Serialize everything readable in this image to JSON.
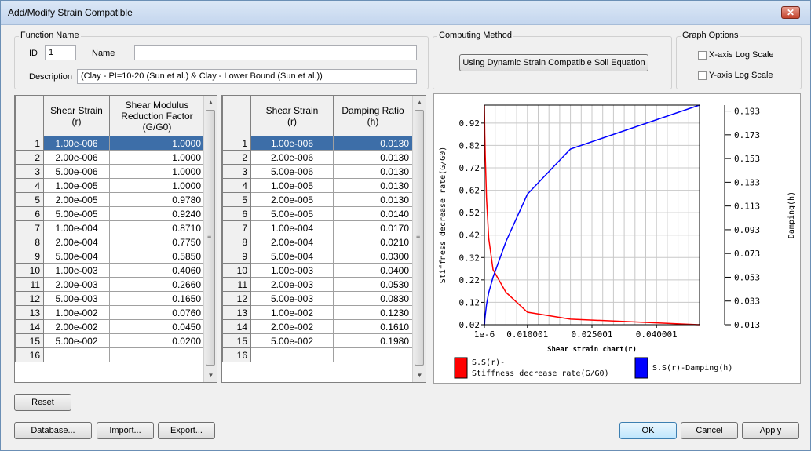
{
  "window": {
    "title": "Add/Modify Strain Compatible",
    "close_glyph": "✕"
  },
  "function_name": {
    "group_label": "Function Name",
    "id_label": "ID",
    "id_value": "1",
    "name_label": "Name",
    "name_value": "",
    "description_label": "Description",
    "description_value": "(Clay - PI=10-20 (Sun et al.) & Clay - Lower Bound (Sun et al.))"
  },
  "computing_method": {
    "group_label": "Computing Method",
    "button_label": "Using Dynamic Strain Compatible Soil Equation"
  },
  "graph_options": {
    "group_label": "Graph Options",
    "x_log_label": "X-axis Log Scale",
    "x_log_checked": false,
    "y_log_label": "Y-axis Log Scale",
    "y_log_checked": false
  },
  "modulus_table": {
    "headers": [
      "Shear Strain\n(r)",
      "Shear Modulus\nReduction Factor\n(G/G0)"
    ],
    "rows": [
      [
        "1",
        "1.00e-006",
        "1.0000"
      ],
      [
        "2",
        "2.00e-006",
        "1.0000"
      ],
      [
        "3",
        "5.00e-006",
        "1.0000"
      ],
      [
        "4",
        "1.00e-005",
        "1.0000"
      ],
      [
        "5",
        "2.00e-005",
        "0.9780"
      ],
      [
        "6",
        "5.00e-005",
        "0.9240"
      ],
      [
        "7",
        "1.00e-004",
        "0.8710"
      ],
      [
        "8",
        "2.00e-004",
        "0.7750"
      ],
      [
        "9",
        "5.00e-004",
        "0.5850"
      ],
      [
        "10",
        "1.00e-003",
        "0.4060"
      ],
      [
        "11",
        "2.00e-003",
        "0.2660"
      ],
      [
        "12",
        "5.00e-003",
        "0.1650"
      ],
      [
        "13",
        "1.00e-002",
        "0.0760"
      ],
      [
        "14",
        "2.00e-002",
        "0.0450"
      ],
      [
        "15",
        "5.00e-002",
        "0.0200"
      ],
      [
        "16",
        "",
        ""
      ]
    ],
    "selected_row": 0
  },
  "damping_table": {
    "headers": [
      "Shear Strain\n(r)",
      "Damping Ratio\n(h)"
    ],
    "rows": [
      [
        "1",
        "1.00e-006",
        "0.0130"
      ],
      [
        "2",
        "2.00e-006",
        "0.0130"
      ],
      [
        "3",
        "5.00e-006",
        "0.0130"
      ],
      [
        "4",
        "1.00e-005",
        "0.0130"
      ],
      [
        "5",
        "2.00e-005",
        "0.0130"
      ],
      [
        "6",
        "5.00e-005",
        "0.0140"
      ],
      [
        "7",
        "1.00e-004",
        "0.0170"
      ],
      [
        "8",
        "2.00e-004",
        "0.0210"
      ],
      [
        "9",
        "5.00e-004",
        "0.0300"
      ],
      [
        "10",
        "1.00e-003",
        "0.0400"
      ],
      [
        "11",
        "2.00e-003",
        "0.0530"
      ],
      [
        "12",
        "5.00e-003",
        "0.0830"
      ],
      [
        "13",
        "1.00e-002",
        "0.1230"
      ],
      [
        "14",
        "2.00e-002",
        "0.1610"
      ],
      [
        "15",
        "5.00e-002",
        "0.1980"
      ],
      [
        "16",
        "",
        ""
      ]
    ],
    "selected_row": 0
  },
  "chart_data": {
    "type": "line",
    "xlabel": "Shear strain chart(r)",
    "ylabel_left": "Stiffness decrease rate(G/G0)",
    "ylabel_right": "Damping(h)",
    "xlim": [
      1e-06,
      0.05
    ],
    "ylim_left": [
      0.02,
      1.0
    ],
    "ylim_right": [
      0.013,
      0.198
    ],
    "x_ticks": [
      "1e-6",
      "0.010001",
      "0.025001",
      "0.040001"
    ],
    "x_tick_values": [
      1e-06,
      0.010001,
      0.025001,
      0.040001
    ],
    "y_ticks_left": [
      "0.92",
      "0.82",
      "0.72",
      "0.62",
      "0.52",
      "0.42",
      "0.32",
      "0.22",
      "0.12",
      "0.02"
    ],
    "y_ticks_right": [
      "0.193",
      "0.173",
      "0.153",
      "0.133",
      "0.113",
      "0.093",
      "0.073",
      "0.053",
      "0.033",
      "0.013"
    ],
    "grid": true,
    "legend_position": "bottom",
    "x": [
      1e-06,
      2e-06,
      5e-06,
      1e-05,
      2e-05,
      5e-05,
      0.0001,
      0.0002,
      0.0005,
      0.001,
      0.002,
      0.005,
      0.01,
      0.02,
      0.05
    ],
    "series": [
      {
        "name": "S.S(r)-\nStiffness decrease rate(G/G0)",
        "color": "#ff0000",
        "axis": "left",
        "values": [
          1.0,
          1.0,
          1.0,
          1.0,
          0.978,
          0.924,
          0.871,
          0.775,
          0.585,
          0.406,
          0.266,
          0.165,
          0.076,
          0.045,
          0.02
        ]
      },
      {
        "name": "S.S(r)-Damping(h)",
        "color": "#0000ff",
        "axis": "right",
        "values": [
          0.013,
          0.013,
          0.013,
          0.013,
          0.013,
          0.014,
          0.017,
          0.021,
          0.03,
          0.04,
          0.053,
          0.083,
          0.123,
          0.161,
          0.198
        ]
      }
    ]
  },
  "buttons": {
    "reset": "Reset",
    "database": "Database...",
    "import": "Import...",
    "export": "Export...",
    "ok": "OK",
    "cancel": "Cancel",
    "apply": "Apply"
  }
}
